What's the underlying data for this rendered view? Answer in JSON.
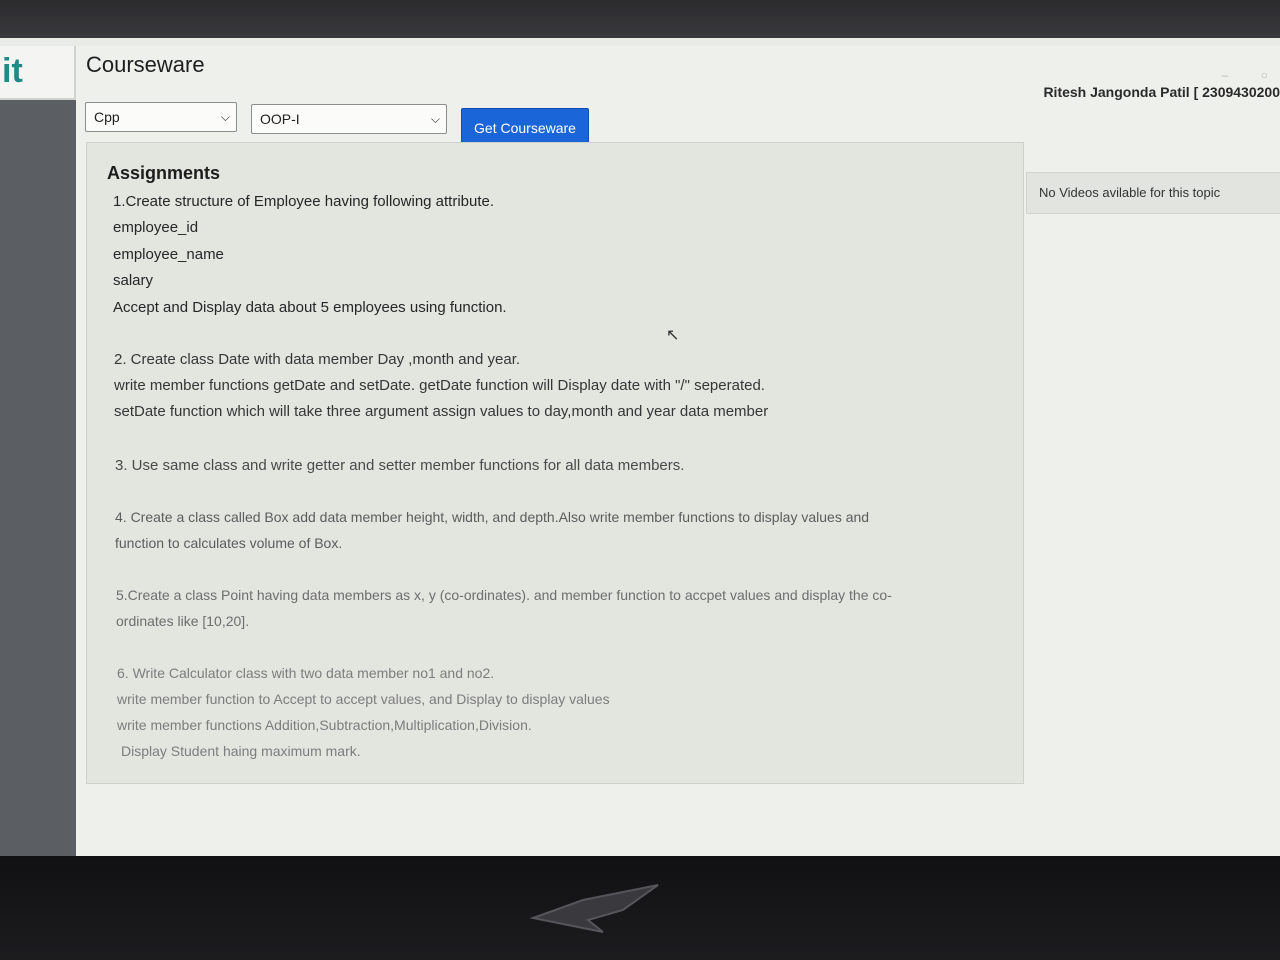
{
  "app": {
    "logo": "it",
    "title": "Courseware",
    "user": "Ritesh Jangonda Patil [ 2309430200"
  },
  "filters": {
    "subject": "Cpp",
    "module": "OOP-I",
    "get_button": "Get Courseware"
  },
  "content": {
    "heading": "Assignments",
    "lines": [
      "1.Create structure of Employee having following attribute.",
      "employee_id",
      "employee_name",
      "salary",
      "Accept and Display data about 5 employees using function.",
      "2. Create class Date with data member Day ,month and year.",
      "write member functions getDate and setDate. getDate function will Display date with \"/\" seperated.",
      "setDate function which will take three argument assign values to day,month and year data member",
      "3. Use same class and write getter and setter member functions for all data members.",
      "4. Create a class called Box  add data member  height, width, and depth.Also write  member functions to display values and",
      "function to calculates volume of Box.",
      "5.Create a class Point having data members as x, y (co-ordinates). and member function  to accpet values and  display  the co-",
      "ordinates like      [10,20].",
      "6. Write Calculator class with two data member no1 and no2.",
      "write member function to Accept to accept values, and Display to display values",
      "write member functions Addition,Subtraction,Multiplication,Division.",
      "Display Student haing maximum mark."
    ]
  },
  "sidebar": {
    "videos_message": "No Videos avilable for this topic"
  },
  "icons": {
    "dropdown": "chevron-down-icon",
    "cursor": "mouse-pointer-icon",
    "brand": "rog-logo-icon"
  }
}
